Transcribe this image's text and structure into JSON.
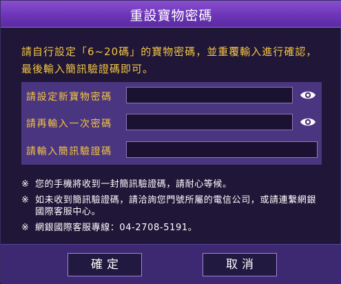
{
  "dialog": {
    "title": "重設寶物密碼"
  },
  "instruction": "請自行設定「6~20碼」的寶物密碼，並重覆輸入進行確認，最後輸入簡訊驗證碼即可。",
  "form": {
    "new_password_label": "請設定新寶物密碼",
    "new_password_value": "",
    "confirm_password_label": "請再輸入一次密碼",
    "confirm_password_value": "",
    "sms_code_label": "請輸入簡訊驗證碼",
    "sms_code_value": "",
    "show_password_icon": "eye-icon"
  },
  "notes": {
    "mark": "※",
    "items": [
      "您的手機將收到一封簡訊驗證碼，請耐心等候。",
      "如未收到簡訊驗證碼，請洽詢您門號所屬的電信公司，或請連繫網銀國際客服中心。",
      "網銀國際客服專線：04-2708-5191。"
    ]
  },
  "buttons": {
    "confirm_label": "確定",
    "cancel_label": "取消"
  },
  "colors": {
    "title_bar": "#6d35b8",
    "background": "#1f1638",
    "accent_text": "#f4c642",
    "form_panel": "#4a3580",
    "footer": "#3d2872"
  }
}
